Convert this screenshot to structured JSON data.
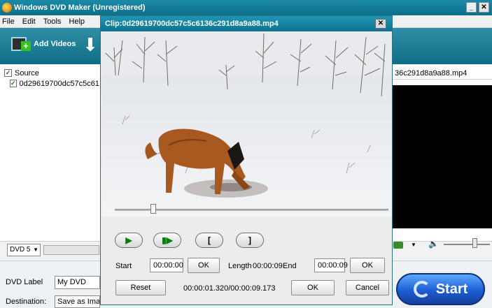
{
  "main": {
    "title": "Windows DVD Maker (Unregistered)",
    "win_min": "_",
    "win_close": "✕",
    "menu": [
      "File",
      "Edit",
      "Tools",
      "Help"
    ],
    "toolbar": {
      "add_videos": "Add Videos"
    },
    "tree": {
      "root": "Source",
      "item": "0d29619700dc57c5c61..."
    },
    "right_filename": "36c291d8a9a88.mp4",
    "dvd_type": "DVD 5",
    "dvd_label_caption": "DVD Label",
    "dvd_label_value": "My DVD",
    "destination_caption": "Destination:",
    "destination_value": "Save as Image File",
    "start_label": "Start"
  },
  "dialog": {
    "title": "Clip:0d29619700dc57c5c6136c291d8a9a88.mp4",
    "close": "✕",
    "seek_fraction": 0.14,
    "play_icon": "▶",
    "step_icon": "▮▶",
    "mark_in_icon": "[",
    "mark_out_icon": "]",
    "start_caption": "Start",
    "start_value": "00:00:00",
    "ok_start": "OK",
    "length_caption": "Length",
    "length_value": "00:00:09",
    "end_caption": "End",
    "end_value": "00:00:09",
    "ok_end": "OK",
    "reset": "Reset",
    "position": "00:00:01.320/00:00:09.173",
    "ok": "OK",
    "cancel": "Cancel"
  }
}
